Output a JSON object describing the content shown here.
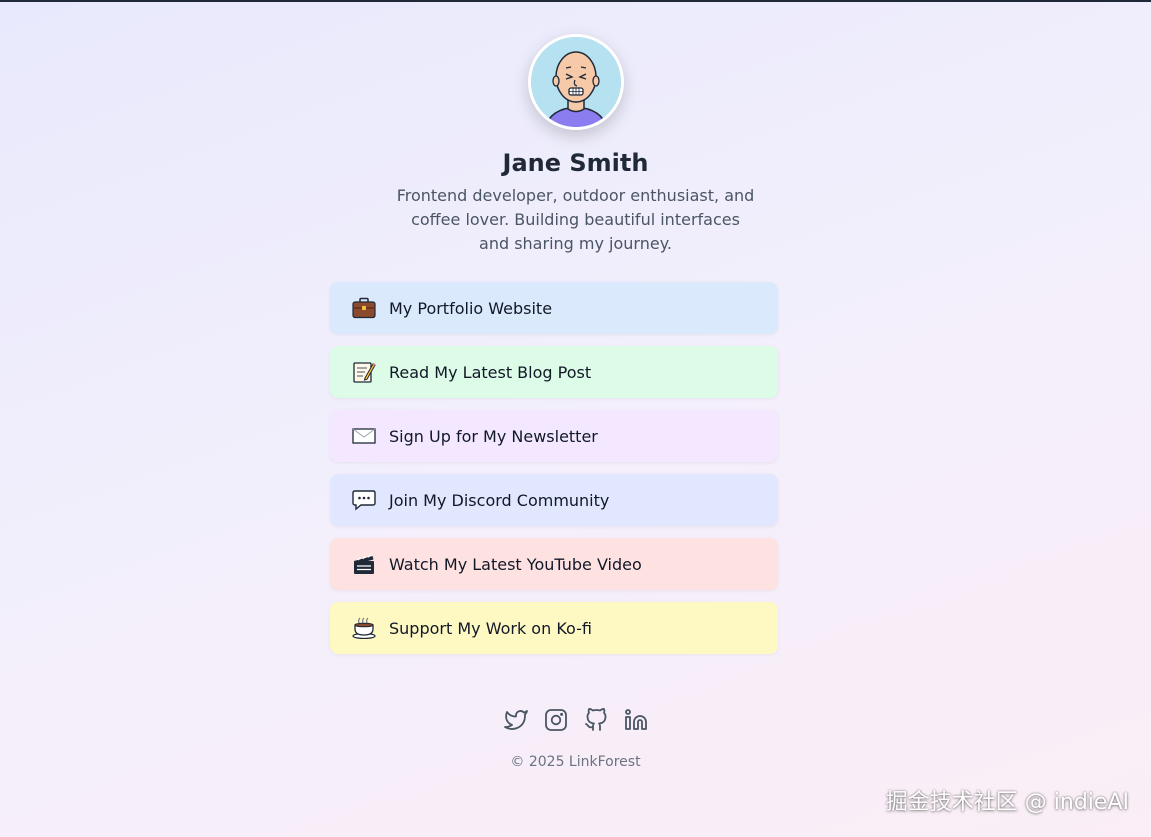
{
  "profile": {
    "name": "Jane Smith",
    "bio": "Frontend developer, outdoor enthusiast, and coffee lover. Building beautiful interfaces and sharing my journey."
  },
  "links": [
    {
      "label": "My Portfolio Website",
      "icon": "briefcase-icon",
      "color": "#dbe9fd"
    },
    {
      "label": "Read My Latest Blog Post",
      "icon": "memo-icon",
      "color": "#dcfce7"
    },
    {
      "label": "Sign Up for My Newsletter",
      "icon": "envelope-icon",
      "color": "#f3e8ff"
    },
    {
      "label": "Join My Discord Community",
      "icon": "chat-bubble-icon",
      "color": "#e0e7ff"
    },
    {
      "label": "Watch My Latest YouTube Video",
      "icon": "clapperboard-icon",
      "color": "#fee2e2"
    },
    {
      "label": "Support My Work on Ko-fi",
      "icon": "coffee-cup-icon",
      "color": "#fef9c3"
    }
  ],
  "socials": [
    "twitter-icon",
    "instagram-icon",
    "github-icon",
    "linkedin-icon"
  ],
  "footer": {
    "copyright": "© 2025 LinkForest"
  },
  "watermark": {
    "text": "掘金技术社区 @ indieAI"
  }
}
